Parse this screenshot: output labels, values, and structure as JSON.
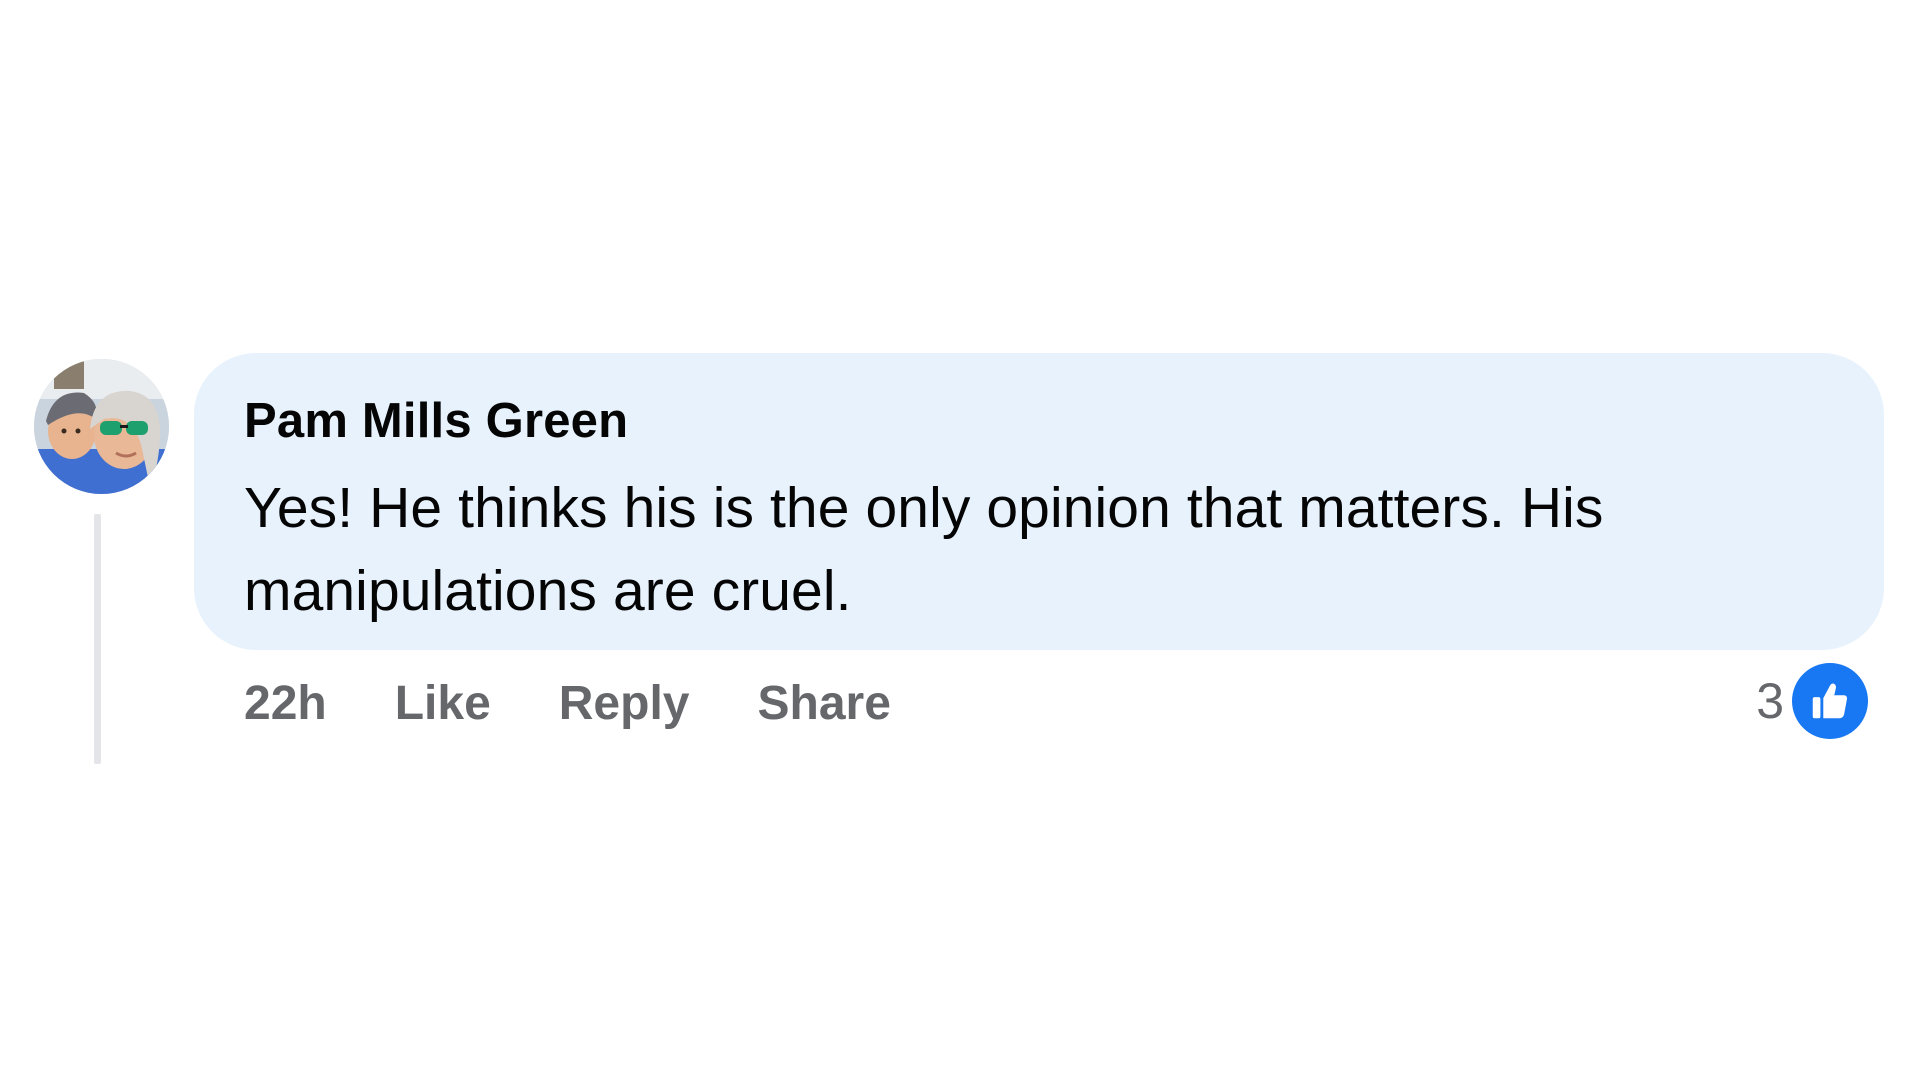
{
  "comment": {
    "author": "Pam Mills Green",
    "text": "Yes! He thinks his is the only opinion that matters. His manipulations are cruel.",
    "avatar_icon": "profile-photo-avatar"
  },
  "actions": {
    "time": "22h",
    "like_label": "Like",
    "reply_label": "Reply",
    "share_label": "Share"
  },
  "reactions": {
    "count": "3",
    "icon": "thumbs-up-icon",
    "color": "#1877f2"
  },
  "colors": {
    "bubble_background": "#e7f2fd",
    "secondary_text": "#65676b",
    "primary_text": "#050505"
  }
}
